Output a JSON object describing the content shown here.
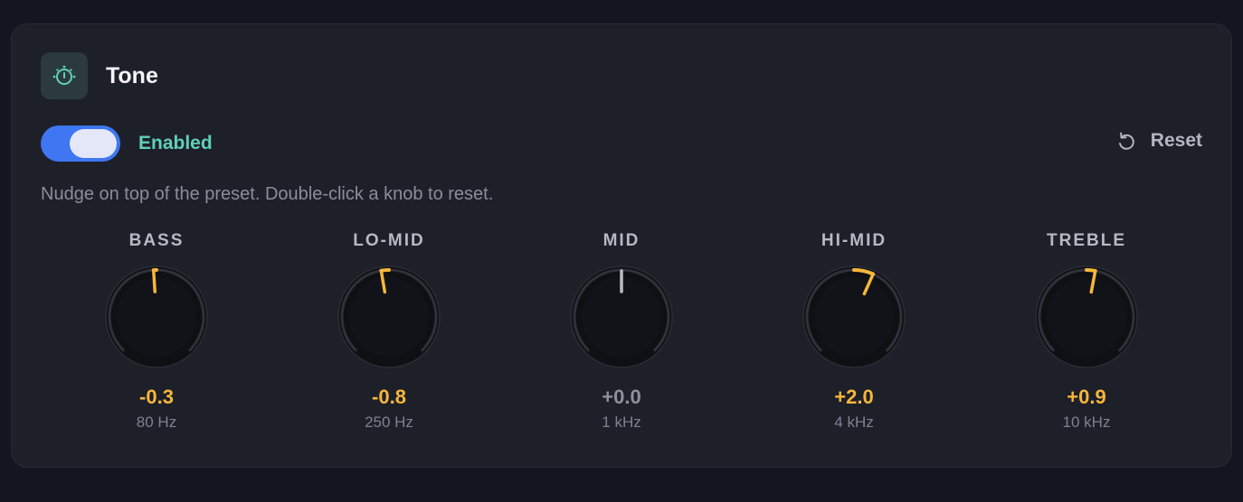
{
  "panel": {
    "title": "Tone",
    "icon": "tuning-knob-icon",
    "toggle": {
      "state": "on",
      "label": "Enabled"
    },
    "reset_label": "Reset",
    "hint": "Nudge on top of the preset. Double-click a knob to reset."
  },
  "bands": [
    {
      "label": "BASS",
      "value": "-0.3",
      "gain": -0.3,
      "freq": "80 Hz"
    },
    {
      "label": "LO-MID",
      "value": "-0.8",
      "gain": -0.8,
      "freq": "250 Hz"
    },
    {
      "label": "MID",
      "value": "+0.0",
      "gain": 0.0,
      "freq": "1 kHz"
    },
    {
      "label": "HI-MID",
      "value": "+2.0",
      "gain": 2.0,
      "freq": "4 kHz"
    },
    {
      "label": "TREBLE",
      "value": "+0.9",
      "gain": 0.9,
      "freq": "10 kHz"
    }
  ],
  "colors": {
    "accent_active": "#f5b73b",
    "neutral": "#8d919c",
    "toggle_on": "#3f77f2",
    "enabled_text": "#5fd0b6"
  }
}
